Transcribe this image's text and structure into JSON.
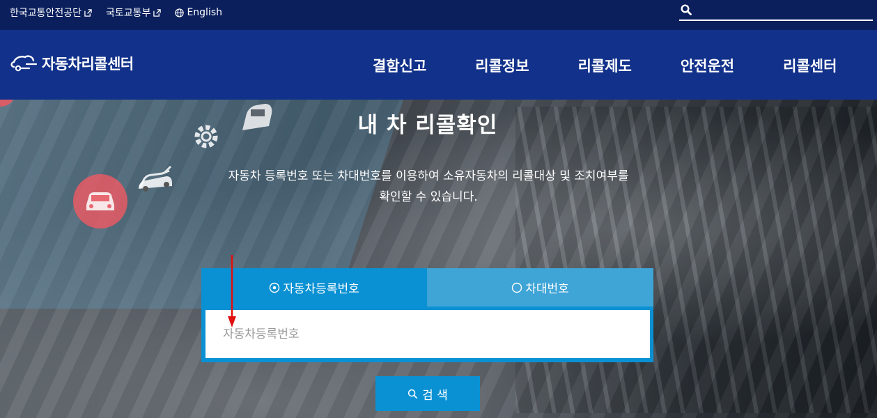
{
  "topbar": {
    "links": [
      {
        "label": "한국교통안전공단",
        "icon": "external-link-icon"
      },
      {
        "label": "국토교통부",
        "icon": "external-link-icon"
      },
      {
        "label": "English",
        "icon": "globe-icon"
      }
    ],
    "search": {
      "placeholder": "",
      "value": ""
    }
  },
  "nav": {
    "logo_text": "자동차리콜센터",
    "menu": [
      "결함신고",
      "리콜정보",
      "리콜제도",
      "안전운전",
      "리콜센터"
    ]
  },
  "hero": {
    "title": "내 차 리콜확인",
    "description_line1": "자동차 등록번호 또는 차대번호를 이용하여 소유자동차의 리콜대상 및 조치여부를",
    "description_line2": "확인할 수 있습니다."
  },
  "search_panel": {
    "tabs": [
      {
        "label": "자동차등록번호",
        "selected": true
      },
      {
        "label": "차대번호",
        "selected": false
      }
    ],
    "input_placeholder": "자동차등록번호",
    "input_value": "",
    "search_button_label": "검 색"
  },
  "colors": {
    "topbar_bg": "#0a1f5c",
    "nav_bg": "#12318a",
    "accent_blue": "#0a91d4",
    "tab_inactive": "#3fa4d6",
    "annotation_red": "#e01010"
  }
}
